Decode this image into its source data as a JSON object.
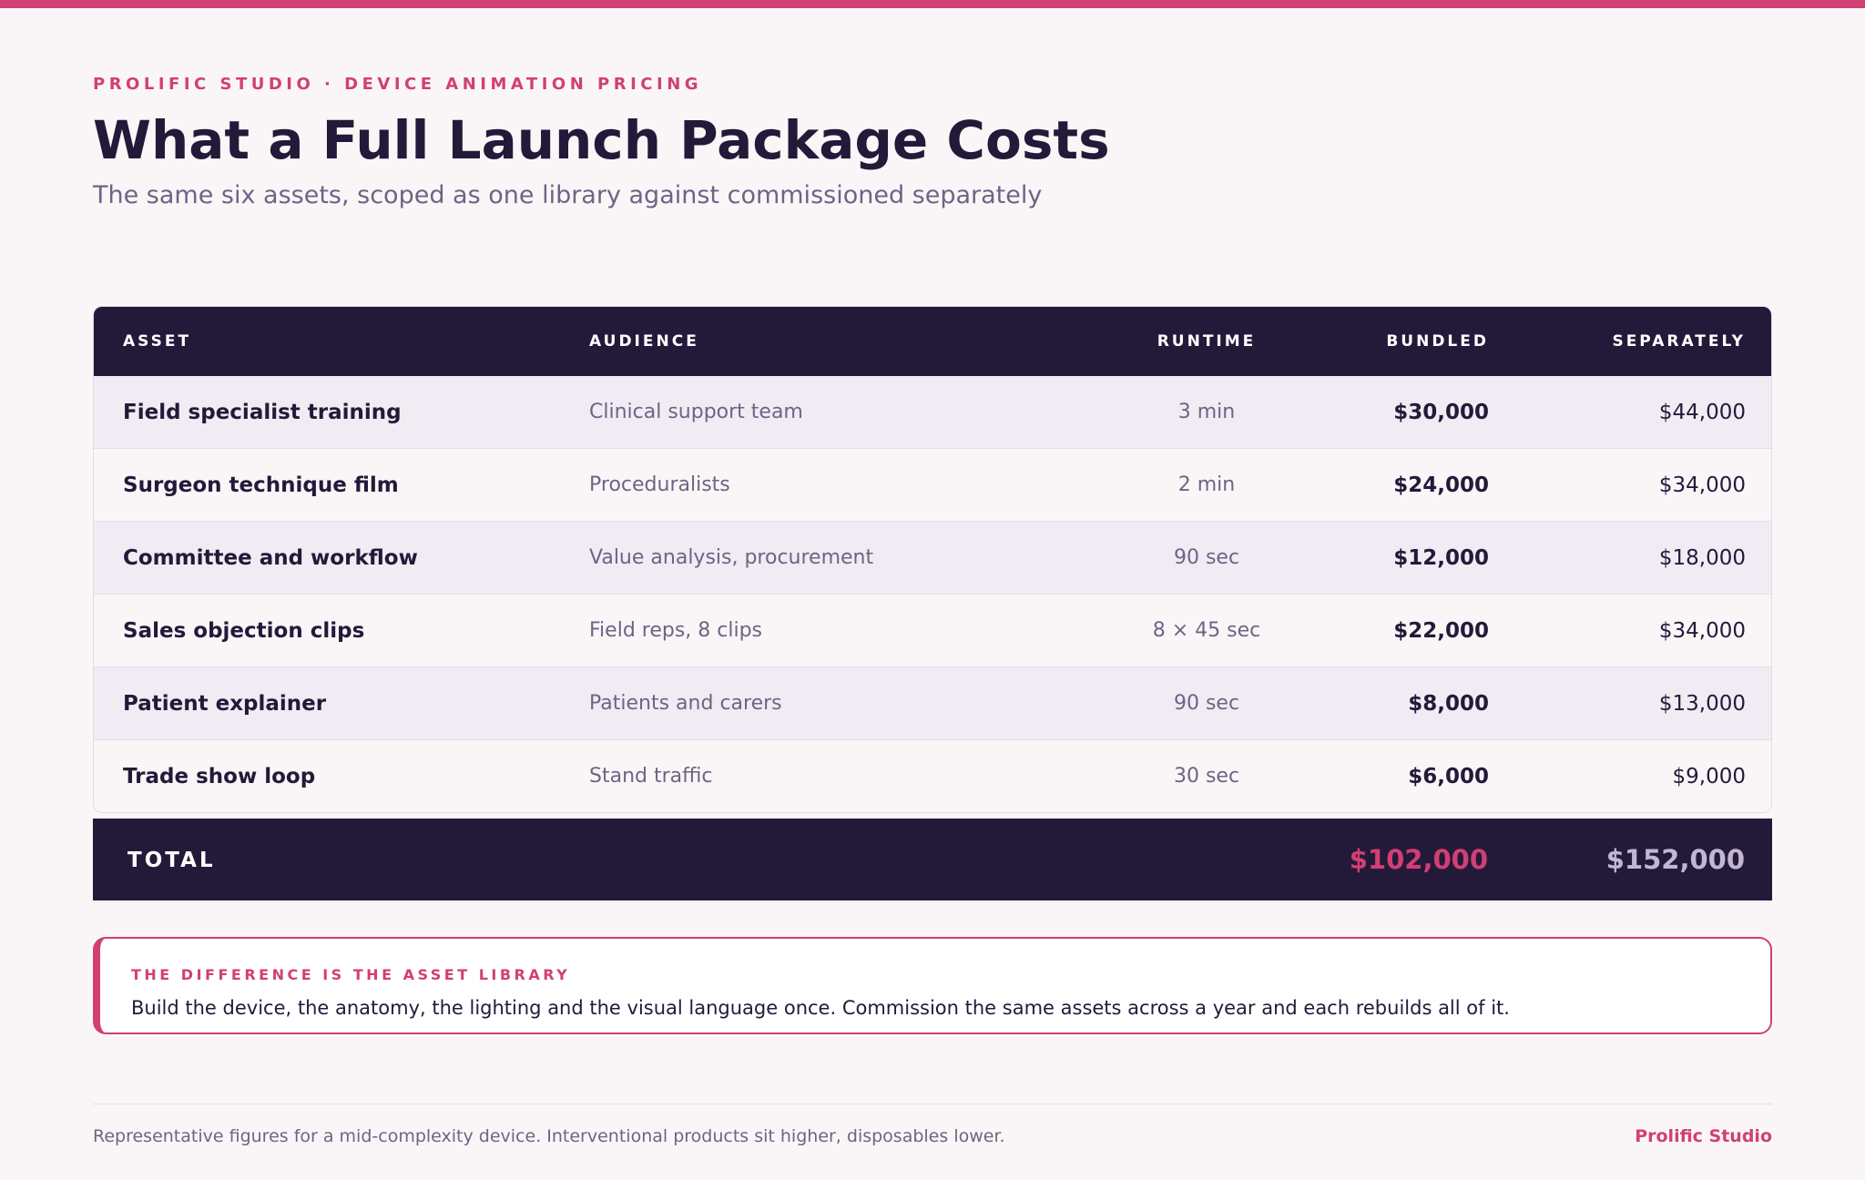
{
  "colors": {
    "accent": "#d23f74",
    "navy": "#231a3a",
    "muted": "#6f6385",
    "background": "#faf6f8",
    "row_alt": "#f1ecf3"
  },
  "header": {
    "eyebrow": "PROLIFIC STUDIO · DEVICE ANIMATION PRICING",
    "title": "What a Full Launch Package Costs",
    "subtitle": "The same six assets, scoped as one library against commissioned separately"
  },
  "table": {
    "columns": [
      "ASSET",
      "AUDIENCE",
      "RUNTIME",
      "BUNDLED",
      "SEPARATELY"
    ],
    "rows": [
      {
        "asset": "Field specialist training",
        "audience": "Clinical support team",
        "runtime": "3 min",
        "bundled": "$30,000",
        "separately": "$44,000"
      },
      {
        "asset": "Surgeon technique film",
        "audience": "Proceduralists",
        "runtime": "2 min",
        "bundled": "$24,000",
        "separately": "$34,000"
      },
      {
        "asset": "Committee and workflow",
        "audience": "Value analysis, procurement",
        "runtime": "90 sec",
        "bundled": "$12,000",
        "separately": "$18,000"
      },
      {
        "asset": "Sales objection clips",
        "audience": "Field reps, 8 clips",
        "runtime": "8 × 45 sec",
        "bundled": "$22,000",
        "separately": "$34,000"
      },
      {
        "asset": "Patient explainer",
        "audience": "Patients and carers",
        "runtime": "90 sec",
        "bundled": "$8,000",
        "separately": "$13,000"
      },
      {
        "asset": "Trade show loop",
        "audience": "Stand traffic",
        "runtime": "30 sec",
        "bundled": "$6,000",
        "separately": "$9,000"
      }
    ],
    "total": {
      "label": "TOTAL",
      "bundled": "$102,000",
      "separately": "$152,000"
    }
  },
  "callout": {
    "title": "THE DIFFERENCE IS THE ASSET LIBRARY",
    "body": "Build the device, the anatomy, the lighting and the visual language once. Commission the same assets across a year and each rebuilds all of it."
  },
  "footer": {
    "note": "Representative figures for a mid-complexity device. Interventional products sit higher, disposables lower.",
    "brand": "Prolific Studio"
  }
}
